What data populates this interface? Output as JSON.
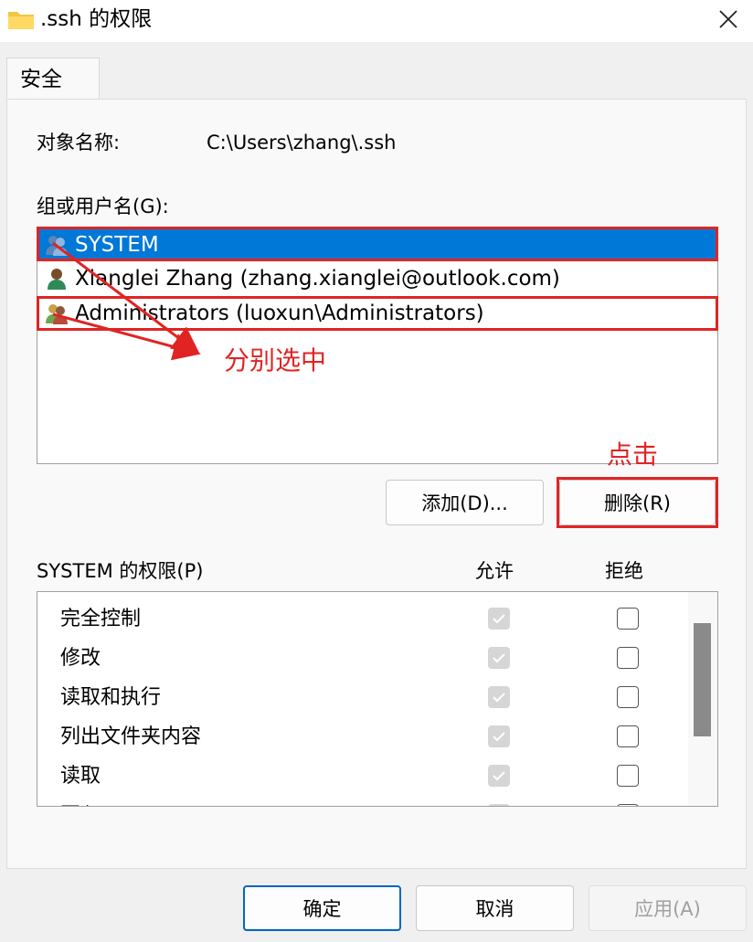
{
  "window": {
    "title": ".ssh 的权限",
    "close_glyph": "✕"
  },
  "tabs": [
    {
      "label": "安全"
    }
  ],
  "object": {
    "label": "对象名称:",
    "value": "C:\\Users\\zhang\\.ssh"
  },
  "groups": {
    "label": "组或用户名(G):",
    "users": [
      {
        "name": "SYSTEM",
        "icon": "group-users-icon",
        "selected": true
      },
      {
        "name": "Xianglei Zhang (zhang.xianglei@outlook.com)",
        "icon": "user-icon",
        "selected": false
      },
      {
        "name": "Administrators (luoxun\\Administrators)",
        "icon": "group-users-icon",
        "selected": false
      }
    ]
  },
  "buttons": {
    "add": "添加(D)...",
    "remove": "删除(R)",
    "ok": "确定",
    "cancel": "取消",
    "apply": "应用(A)"
  },
  "permissions": {
    "label": "SYSTEM 的权限(P)",
    "allow_header": "允许",
    "deny_header": "拒绝",
    "items": [
      {
        "name": "完全控制",
        "allow": true,
        "deny": false
      },
      {
        "name": "修改",
        "allow": true,
        "deny": false
      },
      {
        "name": "读取和执行",
        "allow": true,
        "deny": false
      },
      {
        "name": "列出文件夹内容",
        "allow": true,
        "deny": false
      },
      {
        "name": "读取",
        "allow": true,
        "deny": false
      },
      {
        "name": "写入",
        "allow": true,
        "deny": false
      }
    ]
  },
  "annotations": {
    "select_each": "分别选中",
    "click": "点击",
    "color": "#e02424"
  },
  "colors": {
    "selection": "#0078d7",
    "accent": "#0067c0"
  }
}
